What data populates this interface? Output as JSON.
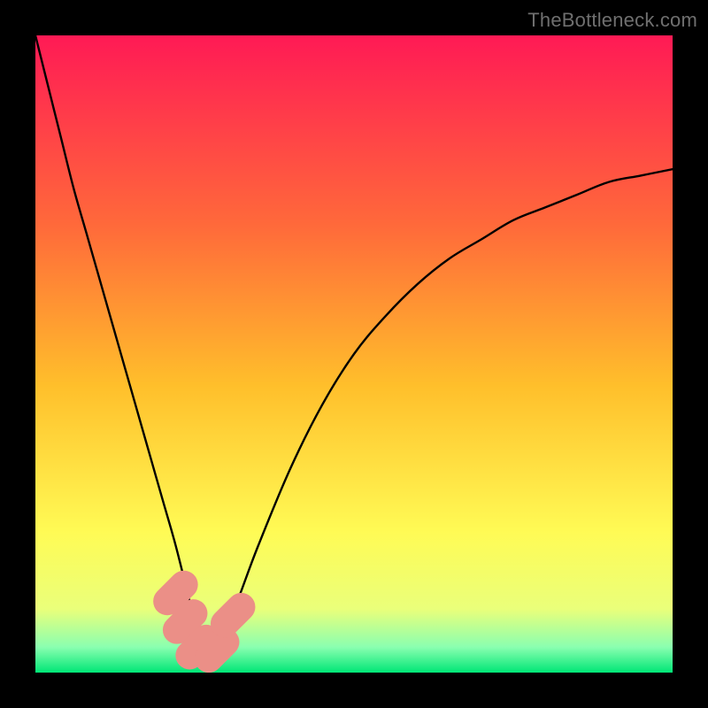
{
  "watermark": "TheBottleneck.com",
  "chart_data": {
    "type": "line",
    "title": "",
    "xlabel": "",
    "ylabel": "",
    "xlim": [
      0,
      100
    ],
    "ylim": [
      0,
      100
    ],
    "grid": false,
    "legend": false,
    "background_gradient": {
      "stops": [
        {
          "offset": 0.0,
          "color": "#ff1a55"
        },
        {
          "offset": 0.3,
          "color": "#ff6a3a"
        },
        {
          "offset": 0.55,
          "color": "#ffbf2b"
        },
        {
          "offset": 0.78,
          "color": "#fffb55"
        },
        {
          "offset": 0.9,
          "color": "#eaff7a"
        },
        {
          "offset": 0.96,
          "color": "#8affb0"
        },
        {
          "offset": 1.0,
          "color": "#00e676"
        }
      ]
    },
    "series": [
      {
        "name": "bottleneck-curve",
        "description": "V-shaped curve; deep narrow minimum near x≈27, left arm rises to top-left corner, right arm rises shallower to upper-right",
        "x": [
          0,
          2,
          4,
          6,
          8,
          10,
          12,
          14,
          16,
          18,
          20,
          22,
          24,
          25,
          26,
          27,
          28,
          29,
          30,
          32,
          35,
          40,
          45,
          50,
          55,
          60,
          65,
          70,
          75,
          80,
          85,
          90,
          95,
          100
        ],
        "y": [
          100,
          92,
          84,
          76,
          69,
          62,
          55,
          48,
          41,
          34,
          27,
          20,
          12,
          8,
          4,
          2,
          2,
          4,
          7,
          12,
          20,
          32,
          42,
          50,
          56,
          61,
          65,
          68,
          71,
          73,
          75,
          77,
          78,
          79
        ]
      }
    ],
    "markers": [
      {
        "name": "node-a",
        "x": 22.0,
        "y": 12.5,
        "color": "#eb8f87",
        "r": 2.6
      },
      {
        "name": "node-b",
        "x": 23.5,
        "y": 8.0,
        "color": "#eb8f87",
        "r": 2.6
      },
      {
        "name": "node-c",
        "x": 25.5,
        "y": 4.0,
        "color": "#eb8f87",
        "r": 2.6
      },
      {
        "name": "node-d",
        "x": 28.5,
        "y": 3.5,
        "color": "#eb8f87",
        "r": 2.6
      },
      {
        "name": "node-e",
        "x": 31.0,
        "y": 9.0,
        "color": "#eb8f87",
        "r": 2.6
      }
    ]
  }
}
